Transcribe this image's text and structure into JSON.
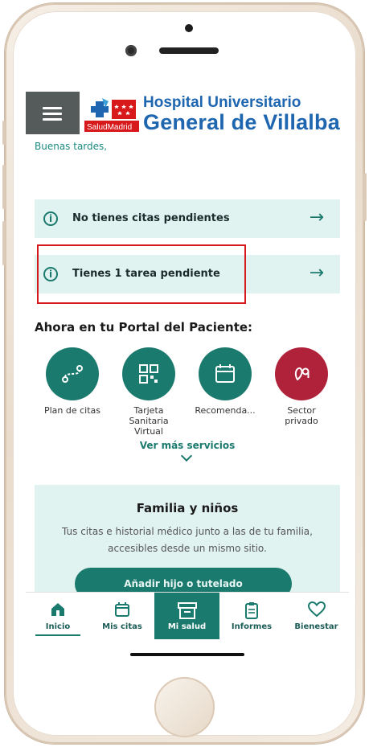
{
  "header": {
    "hospital_line1": "Hospital Universitario",
    "hospital_line2": "General de Villalba",
    "logo_text": "SaludMadrid"
  },
  "greeting": "Buenas tardes,",
  "cards": [
    {
      "label": "No tienes citas pendientes",
      "icon": "info-icon"
    },
    {
      "label": "Tienes 1 tarea pendiente",
      "icon": "info-icon",
      "highlighted": true
    }
  ],
  "section_title": "Ahora en tu Portal del Paciente:",
  "services": [
    {
      "label": "Plan de citas",
      "icon": "route-icon",
      "color": "#1b7a6e"
    },
    {
      "label": "Tarjeta Sanitaria Virtual",
      "icon": "qr-code-icon",
      "color": "#1b7a6e"
    },
    {
      "label": "Recomenda...",
      "icon": "calendar-icon",
      "color": "#1b7a6e"
    },
    {
      "label": "Sector privado",
      "icon": "private-sector-icon",
      "color": "#b0213a"
    }
  ],
  "more_services": "Ver más servicios",
  "family": {
    "title": "Familia y niños",
    "description": "Tus citas e historial médico junto a las de tu familia, accesibles desde un mismo sitio.",
    "button": "Añadir hijo o tutelado"
  },
  "tabs": [
    {
      "label": "Inicio",
      "icon": "home-icon",
      "active": false,
      "selected": true
    },
    {
      "label": "Mis citas",
      "icon": "calendar-icon",
      "active": false
    },
    {
      "label": "Mi salud",
      "icon": "archive-box-icon",
      "active": true
    },
    {
      "label": "Informes",
      "icon": "clipboard-icon",
      "active": false
    },
    {
      "label": "Bienestar",
      "icon": "heart-icon",
      "active": false
    }
  ],
  "colors": {
    "primary": "#1b7a6e",
    "card_bg": "#e1f3f1",
    "brand_blue": "#1f66b0",
    "private_red": "#b0213a",
    "highlight_red": "#d7191c"
  }
}
